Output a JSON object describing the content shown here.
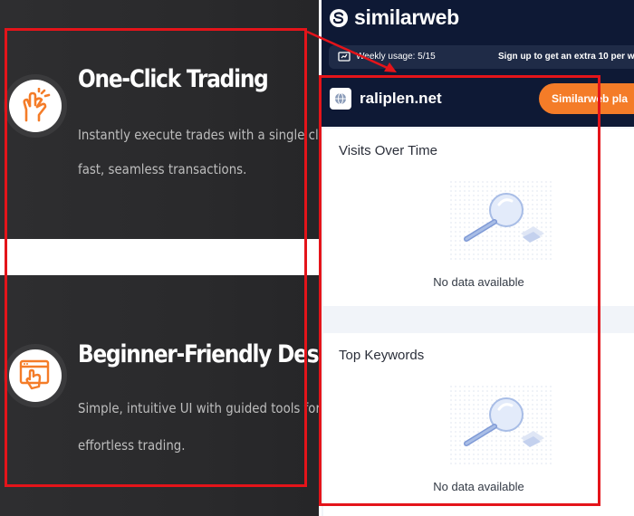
{
  "promo": {
    "feature1": {
      "title": "One-Click Trading",
      "desc_line1": "Instantly execute trades with a single click for",
      "desc_line2": "fast, seamless transactions.",
      "icon": "finger-snap-icon"
    },
    "feature2": {
      "title": "Beginner-Friendly Design",
      "desc_line1": "Simple, intuitive UI with guided tools for",
      "desc_line2": "effortless trading.",
      "icon": "tap-screen-icon"
    }
  },
  "extension": {
    "brand": "similarweb",
    "usage": "Weekly usage: 5/15",
    "signup": "Sign up to get an extra 10 per w",
    "domain": "raliplen.net",
    "plans_button": "Similarweb pla",
    "sections": [
      {
        "title": "Visits Over Time",
        "empty": "No data available"
      },
      {
        "title": "Top Keywords",
        "empty": "No data available"
      }
    ]
  },
  "colors": {
    "annotation": "#e4141a",
    "accent": "#f47c28",
    "panel_bg": "#0e1935",
    "card_bg": "#2e2e30"
  }
}
